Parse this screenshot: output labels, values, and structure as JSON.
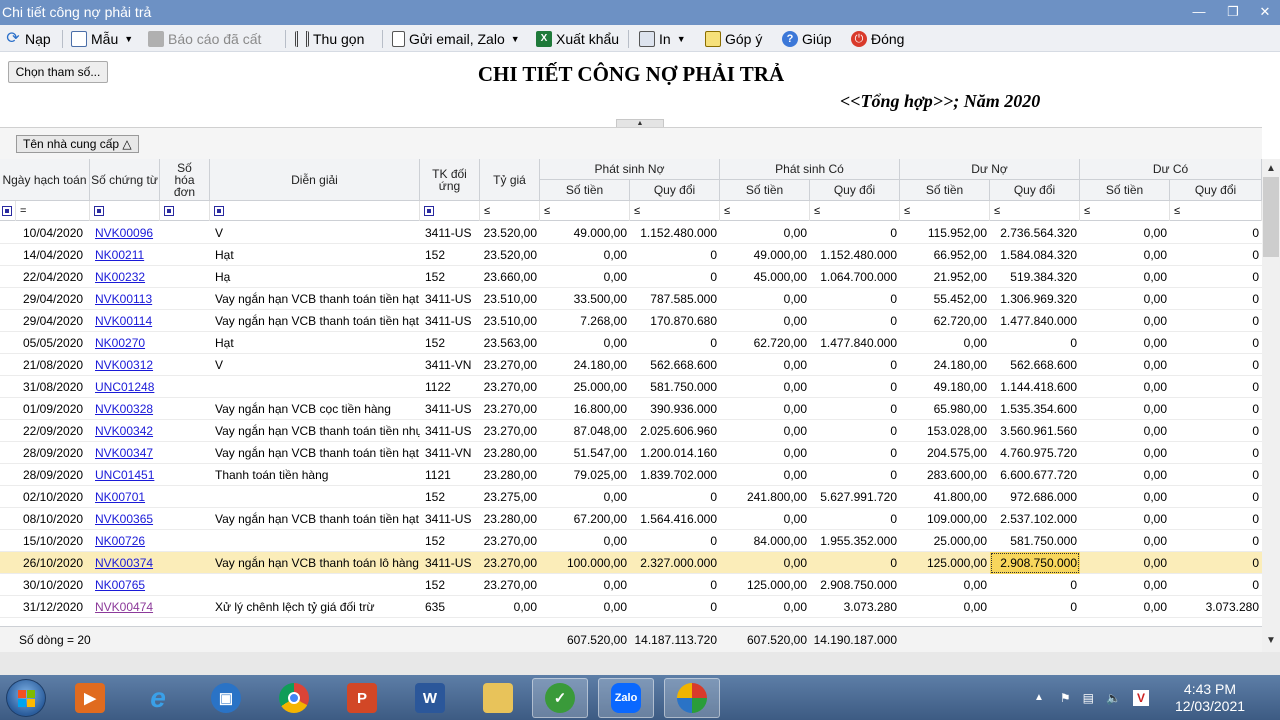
{
  "window": {
    "title": "Chi tiết công nợ phải trả",
    "controls": [
      "minimize",
      "restore",
      "close"
    ]
  },
  "toolbar": {
    "nap": "Nạp",
    "mau": "Mẫu",
    "bao_cao": "Báo cáo đã cất",
    "thu_gon": "Thu gọn",
    "gui_email": "Gửi email, Zalo",
    "xuat_khau": "Xuất khẩu",
    "in": "In",
    "gop_y": "Góp ý",
    "giup": "Giúp",
    "dong": "Đóng"
  },
  "report": {
    "chon_tham_so": "Chọn tham số...",
    "title": "CHI TIẾT CÔNG NỢ PHẢI TRẢ",
    "subtitle": "<<Tổng hợp>>; Năm 2020",
    "group_chip": "Tên nhà cung cấp"
  },
  "grid": {
    "headers": {
      "ngay": "Ngày hạch toán",
      "so_ct": "Số chứng từ",
      "so_hd": "Số hóa đơn",
      "dien_giai": "Diễn giải",
      "tk": "TK đối ứng",
      "ty_gia": "Tỷ giá",
      "ps_no": "Phát sinh Nợ",
      "ps_co": "Phát sinh Có",
      "du_no": "Dư Nợ",
      "du_co": "Dư Có",
      "so_tien": "Số tiền",
      "quy_doi": "Quy đổi"
    },
    "filter": {
      "eq": "=",
      "le": "≤"
    },
    "rows": [
      {
        "ngay": "10/04/2020",
        "so_ct": "NVK00096",
        "so_hd": "",
        "dg": "V",
        "tk": "3411-US",
        "tg": "23.520,00",
        "psn_st": "49.000,00",
        "psn_qd": "1.152.480.000",
        "psc_st": "0,00",
        "psc_qd": "0",
        "dn_st": "115.952,00",
        "dn_qd": "2.736.564.320",
        "dc_st": "0,00",
        "dc_qd": "0"
      },
      {
        "ngay": "14/04/2020",
        "so_ct": "NK00211",
        "so_hd": "",
        "dg": "Hạt",
        "tk": "152",
        "tg": "23.520,00",
        "psn_st": "0,00",
        "psn_qd": "0",
        "psc_st": "49.000,00",
        "psc_qd": "1.152.480.000",
        "dn_st": "66.952,00",
        "dn_qd": "1.584.084.320",
        "dc_st": "0,00",
        "dc_qd": "0"
      },
      {
        "ngay": "22/04/2020",
        "so_ct": "NK00232",
        "so_hd": "",
        "dg": "Hạ",
        "tk": "152",
        "tg": "23.660,00",
        "psn_st": "0,00",
        "psn_qd": "0",
        "psc_st": "45.000,00",
        "psc_qd": "1.064.700.000",
        "dn_st": "21.952,00",
        "dn_qd": "519.384.320",
        "dc_st": "0,00",
        "dc_qd": "0"
      },
      {
        "ngay": "29/04/2020",
        "so_ct": "NVK00113",
        "so_hd": "",
        "dg": "Vay ngắn hạn VCB thanh toán tiền hạt",
        "tk": "3411-US",
        "tg": "23.510,00",
        "psn_st": "33.500,00",
        "psn_qd": "787.585.000",
        "psc_st": "0,00",
        "psc_qd": "0",
        "dn_st": "55.452,00",
        "dn_qd": "1.306.969.320",
        "dc_st": "0,00",
        "dc_qd": "0"
      },
      {
        "ngay": "29/04/2020",
        "so_ct": "NVK00114",
        "so_hd": "",
        "dg": "Vay ngắn hạn VCB thanh toán tiền hạt",
        "tk": "3411-US",
        "tg": "23.510,00",
        "psn_st": "7.268,00",
        "psn_qd": "170.870.680",
        "psc_st": "0,00",
        "psc_qd": "0",
        "dn_st": "62.720,00",
        "dn_qd": "1.477.840.000",
        "dc_st": "0,00",
        "dc_qd": "0"
      },
      {
        "ngay": "05/05/2020",
        "so_ct": "NK00270",
        "so_hd": "",
        "dg": "Hạt",
        "tk": "152",
        "tg": "23.563,00",
        "psn_st": "0,00",
        "psn_qd": "0",
        "psc_st": "62.720,00",
        "psc_qd": "1.477.840.000",
        "dn_st": "0,00",
        "dn_qd": "0",
        "dc_st": "0,00",
        "dc_qd": "0"
      },
      {
        "ngay": "21/08/2020",
        "so_ct": "NVK00312",
        "so_hd": "",
        "dg": "V",
        "tk": "3411-VN",
        "tg": "23.270,00",
        "psn_st": "24.180,00",
        "psn_qd": "562.668.600",
        "psc_st": "0,00",
        "psc_qd": "0",
        "dn_st": "24.180,00",
        "dn_qd": "562.668.600",
        "dc_st": "0,00",
        "dc_qd": "0"
      },
      {
        "ngay": "31/08/2020",
        "so_ct": "UNC01248",
        "so_hd": "",
        "dg": "",
        "tk": "1122",
        "tg": "23.270,00",
        "psn_st": "25.000,00",
        "psn_qd": "581.750.000",
        "psc_st": "0,00",
        "psc_qd": "0",
        "dn_st": "49.180,00",
        "dn_qd": "1.144.418.600",
        "dc_st": "0,00",
        "dc_qd": "0"
      },
      {
        "ngay": "01/09/2020",
        "so_ct": "NVK00328",
        "so_hd": "",
        "dg": "Vay ngắn hạn VCB cọc tiền hàng",
        "tk": "3411-US",
        "tg": "23.270,00",
        "psn_st": "16.800,00",
        "psn_qd": "390.936.000",
        "psc_st": "0,00",
        "psc_qd": "0",
        "dn_st": "65.980,00",
        "dn_qd": "1.535.354.600",
        "dc_st": "0,00",
        "dc_qd": "0"
      },
      {
        "ngay": "22/09/2020",
        "so_ct": "NVK00342",
        "so_hd": "",
        "dg": "Vay ngắn hạn VCB thanh toán tiền nhự",
        "tk": "3411-US",
        "tg": "23.270,00",
        "psn_st": "87.048,00",
        "psn_qd": "2.025.606.960",
        "psc_st": "0,00",
        "psc_qd": "0",
        "dn_st": "153.028,00",
        "dn_qd": "3.560.961.560",
        "dc_st": "0,00",
        "dc_qd": "0"
      },
      {
        "ngay": "28/09/2020",
        "so_ct": "NVK00347",
        "so_hd": "",
        "dg": "Vay ngắn hạn VCB thanh toán tiền hạt",
        "tk": "3411-VN",
        "tg": "23.280,00",
        "psn_st": "51.547,00",
        "psn_qd": "1.200.014.160",
        "psc_st": "0,00",
        "psc_qd": "0",
        "dn_st": "204.575,00",
        "dn_qd": "4.760.975.720",
        "dc_st": "0,00",
        "dc_qd": "0"
      },
      {
        "ngay": "28/09/2020",
        "so_ct": "UNC01451",
        "so_hd": "",
        "dg": "Thanh toán tiền hàng",
        "tk": "1121",
        "tg": "23.280,00",
        "psn_st": "79.025,00",
        "psn_qd": "1.839.702.000",
        "psc_st": "0,00",
        "psc_qd": "0",
        "dn_st": "283.600,00",
        "dn_qd": "6.600.677.720",
        "dc_st": "0,00",
        "dc_qd": "0"
      },
      {
        "ngay": "02/10/2020",
        "so_ct": "NK00701",
        "so_hd": "",
        "dg": "",
        "tk": "152",
        "tg": "23.275,00",
        "psn_st": "0,00",
        "psn_qd": "0",
        "psc_st": "241.800,00",
        "psc_qd": "5.627.991.720",
        "dn_st": "41.800,00",
        "dn_qd": "972.686.000",
        "dc_st": "0,00",
        "dc_qd": "0"
      },
      {
        "ngay": "08/10/2020",
        "so_ct": "NVK00365",
        "so_hd": "",
        "dg": "Vay ngắn hạn VCB thanh toán tiền hạt",
        "tk": "3411-US",
        "tg": "23.280,00",
        "psn_st": "67.200,00",
        "psn_qd": "1.564.416.000",
        "psc_st": "0,00",
        "psc_qd": "0",
        "dn_st": "109.000,00",
        "dn_qd": "2.537.102.000",
        "dc_st": "0,00",
        "dc_qd": "0"
      },
      {
        "ngay": "15/10/2020",
        "so_ct": "NK00726",
        "so_hd": "",
        "dg": "",
        "tk": "152",
        "tg": "23.270,00",
        "psn_st": "0,00",
        "psn_qd": "0",
        "psc_st": "84.000,00",
        "psc_qd": "1.955.352.000",
        "dn_st": "25.000,00",
        "dn_qd": "581.750.000",
        "dc_st": "0,00",
        "dc_qd": "0"
      },
      {
        "ngay": "26/10/2020",
        "so_ct": "NVK00374",
        "so_hd": "",
        "dg": "Vay ngắn hạn VCB thanh toán lô hàng Minh",
        "tk": "3411-US",
        "tg": "23.270,00",
        "psn_st": "100.000,00",
        "psn_qd": "2.327.000.000",
        "psc_st": "0,00",
        "psc_qd": "0",
        "dn_st": "125.000,00",
        "dn_qd": "2.908.750.000",
        "dc_st": "0,00",
        "dc_qd": "0"
      },
      {
        "ngay": "30/10/2020",
        "so_ct": "NK00765",
        "so_hd": "",
        "dg": "",
        "tk": "152",
        "tg": "23.270,00",
        "psn_st": "0,00",
        "psn_qd": "0",
        "psc_st": "125.000,00",
        "psc_qd": "2.908.750.000",
        "dn_st": "0,00",
        "dn_qd": "0",
        "dc_st": "0,00",
        "dc_qd": "0"
      },
      {
        "ngay": "31/12/2020",
        "so_ct": "NVK00474",
        "so_hd": "",
        "dg": "Xử lý chênh lệch tỷ giá đối trừ",
        "tk": "635",
        "tg": "0,00",
        "psn_st": "0,00",
        "psn_qd": "0",
        "psc_st": "0,00",
        "psc_qd": "3.073.280",
        "dn_st": "0,00",
        "dn_qd": "0",
        "dc_st": "0,00",
        "dc_qd": "3.073.280"
      }
    ],
    "selected_row": 15,
    "footer": {
      "so_dong": "Số dòng = 20",
      "psn_st": "607.520,00",
      "psn_qd": "14.187.113.720",
      "psc_st": "607.520,00",
      "psc_qd": "14.190.187.000"
    }
  },
  "taskbar": {
    "apps": [
      "start-button",
      "media-player",
      "internet-explorer",
      "remote-desktop",
      "chrome",
      "powerpoint",
      "word",
      "file-explorer",
      "accounting-app",
      "zalo",
      "snipping-tool"
    ],
    "zalo_label": "Zalo",
    "time": "4:43 PM",
    "date": "12/03/2021"
  },
  "colors": {
    "titlebar": "#6d91c4",
    "link": "#1a1ad8",
    "selected_row": "#fbedb9",
    "focus_cell": "#f7d65c"
  }
}
